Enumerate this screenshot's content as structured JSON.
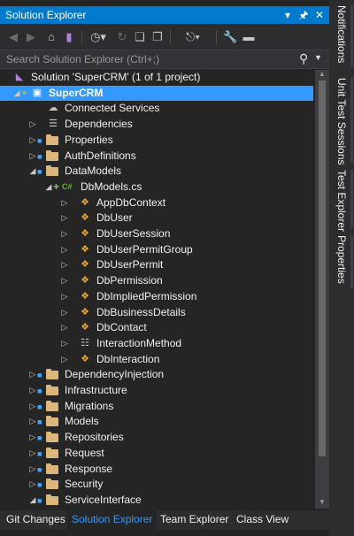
{
  "window": {
    "title": "Solution Explorer",
    "buttons": [
      "dropdown-icon",
      "pin-icon",
      "close-icon"
    ]
  },
  "toolbar": {
    "items": [
      "back-icon",
      "forward-icon",
      "home-icon",
      "vs-icon",
      "history-icon",
      "refresh-icon",
      "collapse-all-icon",
      "show-all-files-icon",
      "sync-icon",
      "properties-icon",
      "preview-icon"
    ]
  },
  "search": {
    "placeholder": "Search Solution Explorer (Ctrl+;)"
  },
  "tree": {
    "rows": [
      {
        "label": "Solution 'SuperCRM' (1 of 1 project)",
        "icon": "solution-icon",
        "depth": 0,
        "expander": "",
        "lock": false,
        "plus": false,
        "selected": false
      },
      {
        "label": "SuperCRM",
        "icon": "csharp-project-icon",
        "depth": 0,
        "expander": "expanded",
        "lock": false,
        "plus": true,
        "selected": true
      },
      {
        "label": "Connected Services",
        "icon": "connected-services-icon",
        "depth": 1,
        "expander": "",
        "lock": false,
        "plus": false,
        "selected": false
      },
      {
        "label": "Dependencies",
        "icon": "dependencies-icon",
        "depth": 1,
        "expander": "collapsed",
        "lock": false,
        "plus": false,
        "selected": false
      },
      {
        "label": "Properties",
        "icon": "properties-folder-icon",
        "depth": 1,
        "expander": "collapsed",
        "lock": true,
        "plus": false,
        "selected": false
      },
      {
        "label": "AuthDefinitions",
        "icon": "folder-icon",
        "depth": 1,
        "expander": "collapsed",
        "lock": true,
        "plus": false,
        "selected": false
      },
      {
        "label": "DataModels",
        "icon": "folder-icon",
        "depth": 1,
        "expander": "expanded",
        "lock": true,
        "plus": false,
        "selected": false
      },
      {
        "label": "DbModels.cs",
        "icon": "csharp-file-icon",
        "depth": 2,
        "expander": "expanded",
        "lock": false,
        "plus": true,
        "selected": false
      },
      {
        "label": "AppDbContext",
        "icon": "class-icon",
        "depth": 3,
        "expander": "collapsed",
        "lock": false,
        "plus": false,
        "selected": false
      },
      {
        "label": "DbUser",
        "icon": "class-icon",
        "depth": 3,
        "expander": "collapsed",
        "lock": false,
        "plus": false,
        "selected": false
      },
      {
        "label": "DbUserSession",
        "icon": "class-icon",
        "depth": 3,
        "expander": "collapsed",
        "lock": false,
        "plus": false,
        "selected": false
      },
      {
        "label": "DbUserPermitGroup",
        "icon": "class-icon",
        "depth": 3,
        "expander": "collapsed",
        "lock": false,
        "plus": false,
        "selected": false
      },
      {
        "label": "DbUserPermit",
        "icon": "class-icon",
        "depth": 3,
        "expander": "collapsed",
        "lock": false,
        "plus": false,
        "selected": false
      },
      {
        "label": "DbPermission",
        "icon": "class-icon",
        "depth": 3,
        "expander": "collapsed",
        "lock": false,
        "plus": false,
        "selected": false
      },
      {
        "label": "DbImpliedPermission",
        "icon": "class-icon",
        "depth": 3,
        "expander": "collapsed",
        "lock": false,
        "plus": false,
        "selected": false
      },
      {
        "label": "DbBusinessDetails",
        "icon": "class-icon",
        "depth": 3,
        "expander": "collapsed",
        "lock": false,
        "plus": false,
        "selected": false
      },
      {
        "label": "DbContact",
        "icon": "class-icon",
        "depth": 3,
        "expander": "collapsed",
        "lock": false,
        "plus": false,
        "selected": false
      },
      {
        "label": "InteractionMethod",
        "icon": "enum-icon",
        "depth": 3,
        "expander": "collapsed",
        "lock": false,
        "plus": false,
        "selected": false
      },
      {
        "label": "DbInteraction",
        "icon": "class-icon",
        "depth": 3,
        "expander": "collapsed",
        "lock": false,
        "plus": false,
        "selected": false
      },
      {
        "label": "DependencyInjection",
        "icon": "folder-icon",
        "depth": 1,
        "expander": "collapsed",
        "lock": true,
        "plus": false,
        "selected": false
      },
      {
        "label": "Infrastructure",
        "icon": "folder-icon",
        "depth": 1,
        "expander": "collapsed",
        "lock": true,
        "plus": false,
        "selected": false
      },
      {
        "label": "Migrations",
        "icon": "folder-icon",
        "depth": 1,
        "expander": "collapsed",
        "lock": true,
        "plus": false,
        "selected": false
      },
      {
        "label": "Models",
        "icon": "folder-icon",
        "depth": 1,
        "expander": "collapsed",
        "lock": true,
        "plus": false,
        "selected": false
      },
      {
        "label": "Repositories",
        "icon": "folder-icon",
        "depth": 1,
        "expander": "collapsed",
        "lock": true,
        "plus": false,
        "selected": false
      },
      {
        "label": "Request",
        "icon": "folder-icon",
        "depth": 1,
        "expander": "collapsed",
        "lock": true,
        "plus": false,
        "selected": false
      },
      {
        "label": "Response",
        "icon": "folder-icon",
        "depth": 1,
        "expander": "collapsed",
        "lock": true,
        "plus": false,
        "selected": false
      },
      {
        "label": "Security",
        "icon": "folder-icon",
        "depth": 1,
        "expander": "collapsed",
        "lock": true,
        "plus": false,
        "selected": false
      },
      {
        "label": "ServiceInterface",
        "icon": "folder-icon",
        "depth": 1,
        "expander": "expanded",
        "lock": true,
        "plus": false,
        "selected": false
      }
    ]
  },
  "bottom_tabs": [
    {
      "label": "Git Changes",
      "active": false
    },
    {
      "label": "Solution Explorer",
      "active": true
    },
    {
      "label": "Team Explorer",
      "active": false
    },
    {
      "label": "Class View",
      "active": false
    }
  ],
  "side_tabs": [
    {
      "label": "Notifications"
    },
    {
      "label": "Unit Test Sessions"
    },
    {
      "label": "Test Explorer"
    },
    {
      "label": "Properties"
    }
  ],
  "colors": {
    "accent": "#007acc",
    "selection": "#3399ff",
    "panel_bg": "#252526",
    "text": "#f1f1f1",
    "folder": "#dcb67a",
    "class_icon": "#e8a735",
    "csharp": "#68b723"
  }
}
